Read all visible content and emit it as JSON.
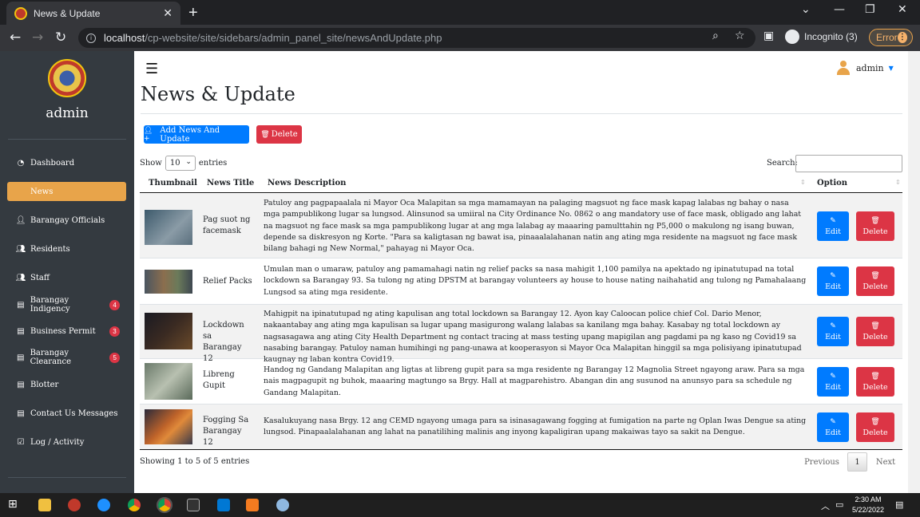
{
  "browser": {
    "tab_title": "News & Update",
    "url_host": "localhost",
    "url_path": "/cp-website/site/sidebars/admin_panel_site/newsAndUpdate.php",
    "incognito_label": "Incognito (3)",
    "error_label": "Error"
  },
  "sidebar": {
    "user": "admin",
    "items": [
      {
        "label": "Dashboard",
        "icon": "dashboard-icon"
      },
      {
        "label": "News",
        "icon": "news-icon"
      },
      {
        "label": "Barangay Officials",
        "icon": "user-icon"
      },
      {
        "label": "Residents",
        "icon": "users-icon"
      },
      {
        "label": "Staff",
        "icon": "users-icon"
      },
      {
        "label": "Barangay Indigency",
        "icon": "file-icon",
        "badge": "4"
      },
      {
        "label": "Business Permit",
        "icon": "file-icon",
        "badge": "3"
      },
      {
        "label": "Barangay Clearance",
        "icon": "file-icon",
        "badge": "5"
      },
      {
        "label": "Blotter",
        "icon": "file-icon"
      },
      {
        "label": "Contact Us Messages",
        "icon": "file-icon"
      },
      {
        "label": "Log / Activity",
        "icon": "check-file-icon"
      }
    ]
  },
  "header": {
    "user_name": "admin",
    "page_title": "News & Update"
  },
  "toolbar": {
    "add_label": "Add News And Update",
    "delete_label": "Delete"
  },
  "table_controls": {
    "show_label": "Show",
    "entries_value": "10",
    "entries_label": "entries",
    "search_label": "Search:"
  },
  "table": {
    "columns": [
      "Thumbnail",
      "News Title",
      "News Description",
      "Option"
    ],
    "edit_label": "Edit",
    "delete_label": "Delete",
    "rows": [
      {
        "title": "Pag suot ng facemask",
        "description": "Patuloy ang pagpapaalala ni Mayor Oca Malapitan sa mga mamamayan na palaging magsuot ng face mask kapag lalabas ng bahay o nasa mga pampublikong lugar sa lungsod. Alinsunod sa umiiral na City Ordinance No. 0862 o ang mandatory use of face mask, obligado ang lahat na magsuot ng face mask sa mga pampublikong lugar at ang mga lalabag ay maaaring pamulttahin ng P5,000 o makulong ng isang buwan, depende sa diskresyon ng Korte. \"Para sa kaligtasan ng bawat isa, pinaaalalahanan natin ang ating mga residente na magsuot ng face mask bilang bahagi ng New Normal,\" pahayag ni Mayor Oca."
      },
      {
        "title": "Relief Packs",
        "description": "Umulan man o umaraw, patuloy ang pamamahagi natin ng relief packs sa nasa mahigit 1,100 pamilya na apektado ng ipinatutupad na total lockdown sa Barangay 93. Sa tulong ng ating DPSTM at barangay volunteers ay house to house nating naihahatid ang tulong ng Pamahalaang Lungsod sa ating mga residente."
      },
      {
        "title": "Lockdown sa Barangay 12",
        "description": "Mahigpit na ipinatutupad ng ating kapulisan ang total lockdown sa Barangay 12. Ayon kay Caloocan police chief Col. Dario Menor, nakaantabay ang ating mga kapulisan sa lugar upang masigurong walang lalabas sa kanilang mga bahay. Kasabay ng total lockdown ay nagsasagawa ang ating City Health Department ng contact tracing at mass testing upang mapigilan ang pagdami pa ng kaso ng Covid19 sa nasabing barangay. Patuloy naman humihingi ng pang-unawa at kooperasyon si Mayor Oca Malapitan hinggil sa mga polisiyang ipinatutupad kaugnay ng laban kontra Covid19."
      },
      {
        "title": "Libreng Gupit",
        "description": "Handog ng Gandang Malapitan ang ligtas at libreng gupit para sa mga residente ng Barangay 12 Magnolia Street ngayong araw. Para sa mga nais magpagupit ng buhok, maaaring magtungo sa Brgy. Hall at magparehistro. Abangan din ang susunod na anunsyo para sa schedule ng Gandang Malapitan."
      },
      {
        "title": "Fogging Sa Barangay 12",
        "description": "Kasalukuyang nasa Brgy. 12 ang CEMD ngayong umaga para sa isinasagawang fogging at fumigation na parte ng Oplan Iwas Dengue sa ating lungsod. Pinapaalalahanan ang lahat na panatilihing malinis ang inyong kapaligiran upang makaiwas tayo sa sakit na Dengue."
      }
    ]
  },
  "footer": {
    "showing": "Showing 1 to 5 of 5 entries",
    "previous": "Previous",
    "page": "1",
    "next": "Next"
  },
  "taskbar": {
    "time": "2:30 AM",
    "date": "5/22/2022"
  },
  "colors": {
    "sidebar_bg": "#343a40",
    "active_item": "#e8a44a",
    "primary": "#007bff",
    "danger": "#dc3545"
  }
}
